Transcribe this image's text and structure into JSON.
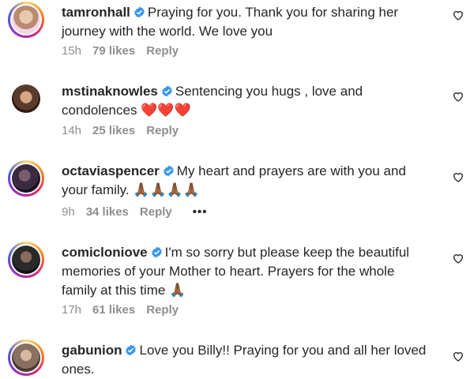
{
  "comments": [
    {
      "username": "tamronhall",
      "text": "Praying for you. Thank you for sharing her journey with the world. We love you",
      "time": "15h",
      "likes": "79 likes",
      "reply": "Reply",
      "avatar_color": "#c9a98f",
      "ring": true
    },
    {
      "username": "mstinaknowles",
      "text": "Sentencing you hugs , love and condolences ❤️❤️❤️",
      "time": "14h",
      "likes": "25 likes",
      "reply": "Reply",
      "avatar_color": "#6b4a3a",
      "ring": false
    },
    {
      "username": "octaviaspencer",
      "text": "My heart and prayers are with you and your family. 🙏🏾🙏🏾🙏🏾🙏🏾",
      "time": "9h",
      "likes": "34 likes",
      "reply": "Reply",
      "more": "•••",
      "avatar_color": "#3a2a40",
      "ring": true
    },
    {
      "username": "comicloniove",
      "text": "I'm so sorry but please keep the beautiful memories of your Mother to heart. Prayers for the whole family at this time 🙏🏾",
      "time": "17h",
      "likes": "61 likes",
      "reply": "Reply",
      "avatar_color": "#2a2a2a",
      "ring": true
    },
    {
      "username": "gabunion",
      "text": "Love you Billy!! Praying for you and all her loved ones.",
      "avatar_color": "#8a7060",
      "ring": true
    }
  ],
  "colors": {
    "verified": "#3897f0",
    "meta": "#8e8e8e",
    "text": "#262626"
  }
}
